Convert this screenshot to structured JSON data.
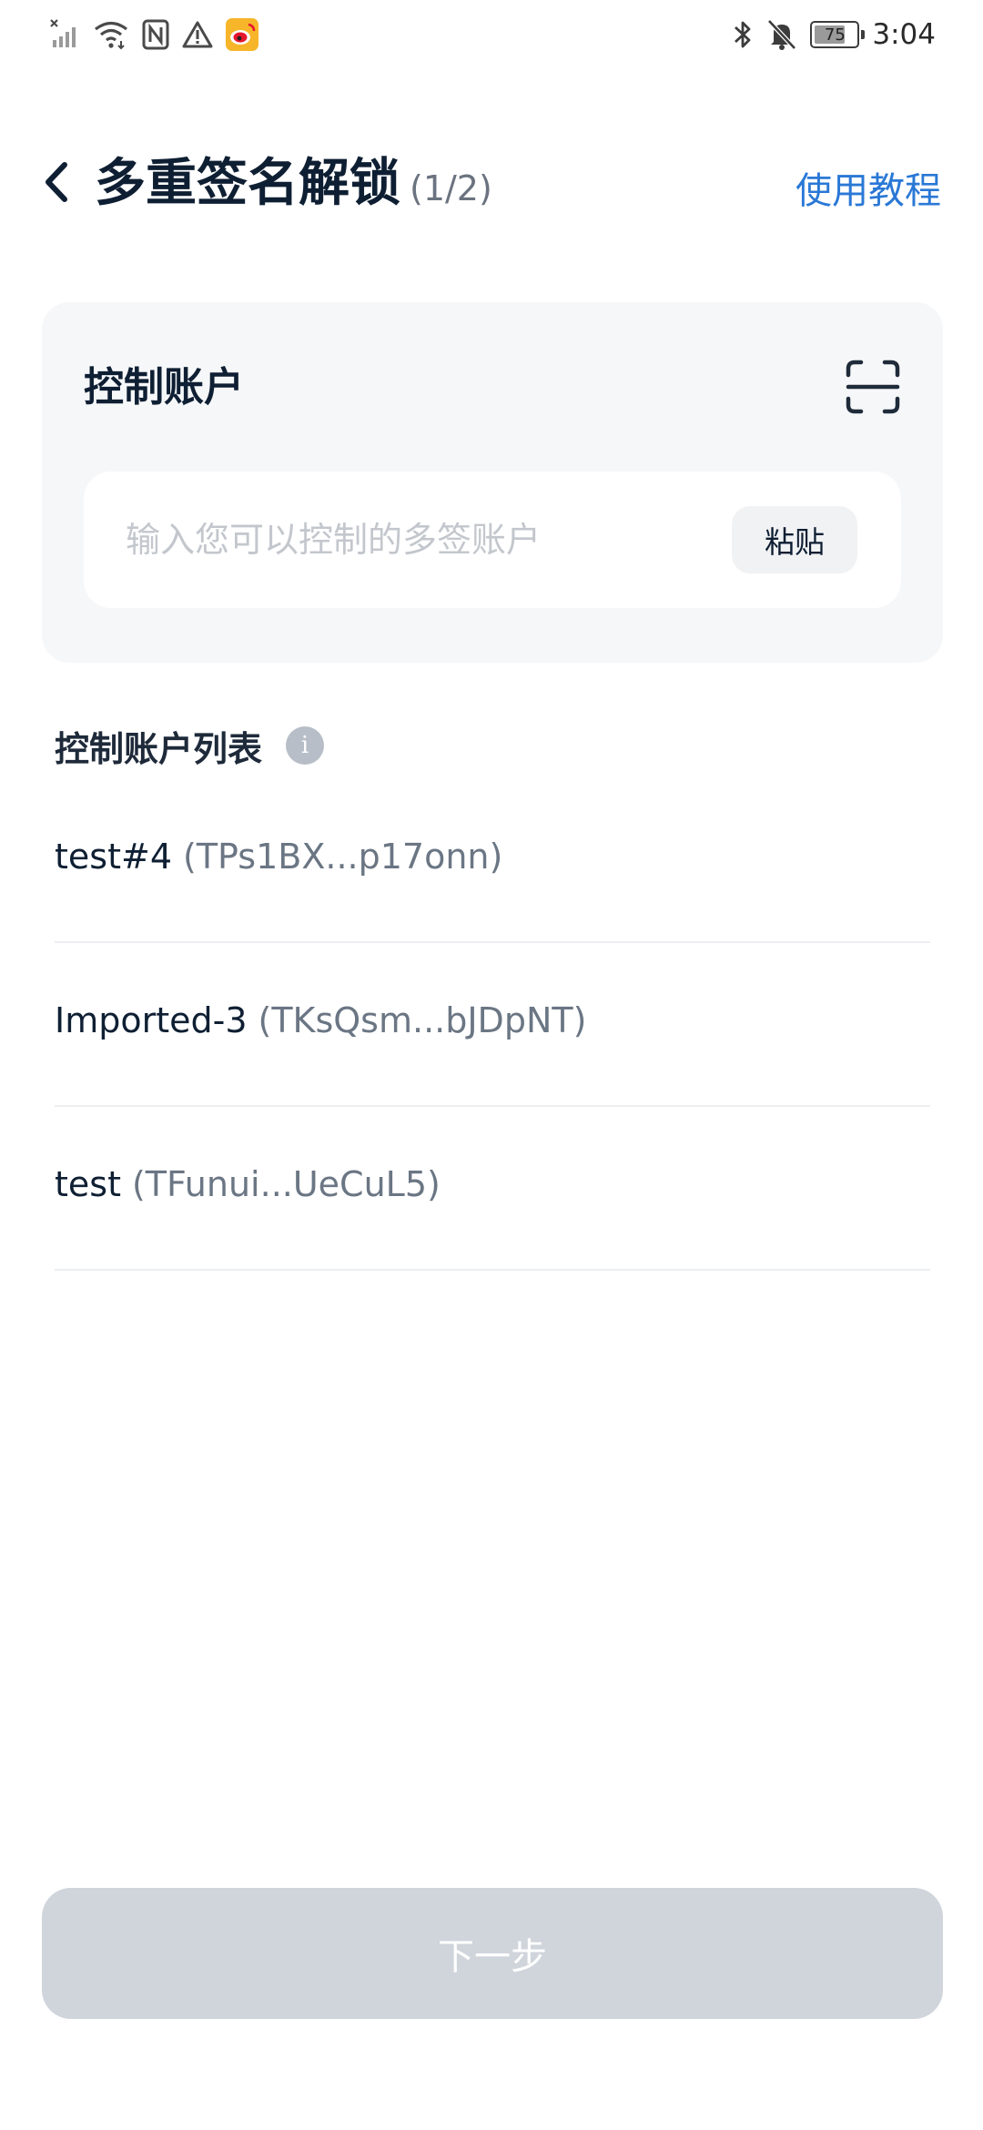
{
  "status_bar": {
    "time": "3:04",
    "battery": 75,
    "battery_text": "75",
    "left_icons": [
      "no-signal-icon",
      "wifi-icon",
      "nfc-icon",
      "warning-icon",
      "weibo-icon"
    ],
    "right_icons": [
      "bluetooth-icon",
      "bell-off-icon",
      "battery-icon"
    ]
  },
  "header": {
    "title": "多重签名解锁",
    "step": "(1/2)",
    "tutorial_label": "使用教程"
  },
  "control_account": {
    "title": "控制账户",
    "input_placeholder": "输入您可以控制的多签账户",
    "input_value": "",
    "paste_label": "粘贴"
  },
  "account_list": {
    "title": "控制账户列表",
    "info_glyph": "i",
    "items": [
      {
        "name": "test#4",
        "address": "(TPs1BX...p17onn)"
      },
      {
        "name": "Imported-3",
        "address": "(TKsQsm...bJDpNT)"
      },
      {
        "name": "test",
        "address": "(TFunui...UeCuL5)"
      }
    ]
  },
  "footer": {
    "next_label": "下一步",
    "next_enabled": false
  },
  "colors": {
    "accent": "#2a78d6",
    "title": "#0f1f33",
    "muted": "#6b7684",
    "card_bg": "#f6f7f9",
    "button_disabled": "#d0d4db"
  }
}
